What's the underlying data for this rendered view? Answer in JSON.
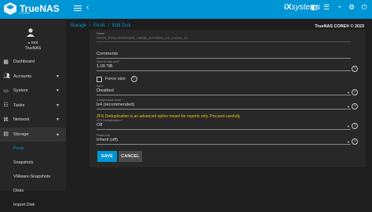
{
  "header": {
    "brand": "TrueNAS",
    "brand_sub": "CORE",
    "vendor_prefix": "iX",
    "vendor_suffix": "systems"
  },
  "sidebar": {
    "user": "root",
    "host": "TrueNAS",
    "items": [
      {
        "label": "Dashboard",
        "icon": "dashboard-icon"
      },
      {
        "label": "Accounts",
        "icon": "accounts-icon",
        "caret": "▼"
      },
      {
        "label": "System",
        "icon": "system-icon",
        "caret": "▼"
      },
      {
        "label": "Tasks",
        "icon": "tasks-icon",
        "caret": "▼"
      },
      {
        "label": "Network",
        "icon": "network-icon",
        "caret": "▼"
      },
      {
        "label": "Storage",
        "icon": "storage-icon",
        "caret": "▲"
      }
    ],
    "storage_sub": [
      "Pools",
      "Snapshots",
      "VMware-Snapshots",
      "Disks",
      "Import Disk"
    ]
  },
  "breadcrumb": [
    "Storage",
    "/",
    "Pools",
    "/",
    "Edit Zvol"
  ],
  "version_label": "TrueNAS CORE® © 2023",
  "form": {
    "name_label": "Name",
    "name_value": "PARIS_POOL/WINDOWS_VM/SB_SHARE01_VG_LUN01_12",
    "comments_label": "Comments",
    "size_label": "Size for this zvol *",
    "size_value": "1.00 TiB",
    "force_size_label": "Force size",
    "sync_label": "Sync",
    "sync_value": "Disabled",
    "compression_label": "Compression level *",
    "compression_value": "lz4 (recommended)",
    "dedup_warning": "ZFS Deduplication is an advanced option meant for experts only. Proceed carefully",
    "dedup_label": "ZFS Deduplication *",
    "dedup_value": "Off",
    "readonly_label": "Read-only",
    "readonly_value": "Inherit (off)",
    "save_label": "SAVE",
    "cancel_label": "CANCEL"
  },
  "colors": {
    "accent": "#0095d5",
    "warning": "#f0c419",
    "background": "#1e1e1e",
    "sidebar": "#262626",
    "card": "#282828"
  }
}
